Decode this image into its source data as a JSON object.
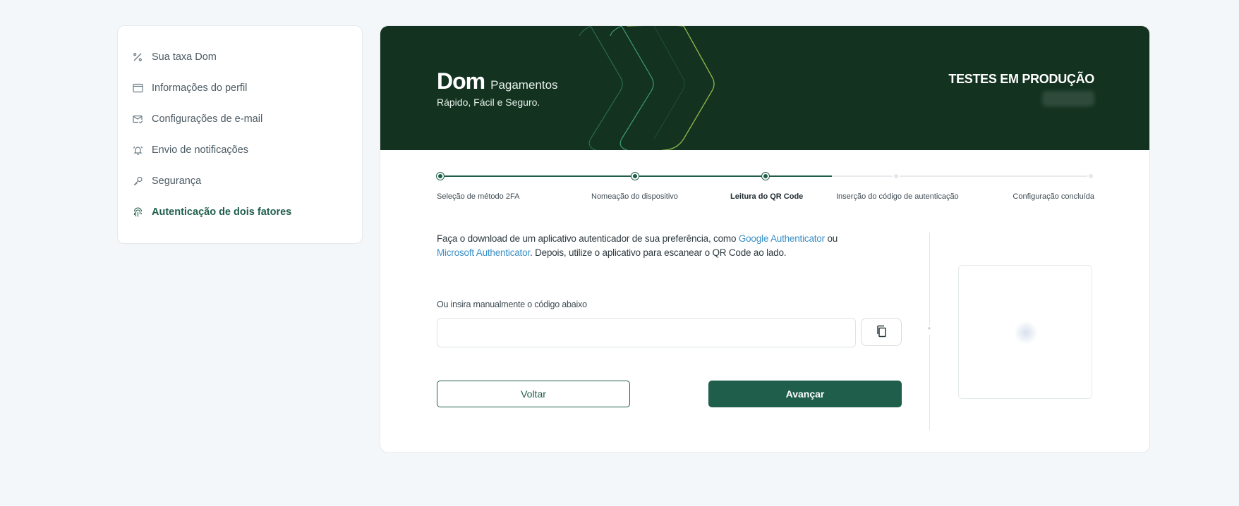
{
  "sidebar": {
    "items": [
      {
        "label": "Sua taxa Dom",
        "icon": "percent-icon"
      },
      {
        "label": "Informações do perfil",
        "icon": "browser-window-icon"
      },
      {
        "label": "Configurações de e-mail",
        "icon": "mail-check-icon"
      },
      {
        "label": "Envio de notificações",
        "icon": "bell-ring-icon"
      },
      {
        "label": "Segurança",
        "icon": "key-icon"
      },
      {
        "label": "Autenticação de dois fatores",
        "icon": "fingerprint-icon",
        "active": true
      }
    ]
  },
  "banner": {
    "logo": "Dom",
    "logo_sub": "Pagamentos",
    "tagline": "Rápido, Fácil e Seguro.",
    "environment": "TESTES EM PRODUÇÃO",
    "bg_color": "#133220"
  },
  "stepper": {
    "steps": [
      {
        "label": "Seleção de método 2FA",
        "state": "done"
      },
      {
        "label": "Nomeação do dispositivo",
        "state": "done"
      },
      {
        "label": "Leitura do QR Code",
        "state": "current"
      },
      {
        "label": "Inserção do código de autenticação",
        "state": "pending"
      },
      {
        "label": "Configuração concluída",
        "state": "pending"
      }
    ]
  },
  "content": {
    "desc_part1": "Faça o download de um aplicativo autenticador de sua preferência, como ",
    "link1": "Google Authenticator",
    "desc_part2": " ou ",
    "link2": "Microsoft Authenticator",
    "desc_part3": ". Depois, utilize o aplicativo para escanear o QR Code ao lado.",
    "manual_label": "Ou insira manualmente o código abaixo",
    "code_value": "",
    "back_label": "Voltar",
    "next_label": "Avançar",
    "divider_glyph": "*"
  },
  "colors": {
    "accent": "#1f5e4b",
    "link": "#3a8fc7"
  }
}
